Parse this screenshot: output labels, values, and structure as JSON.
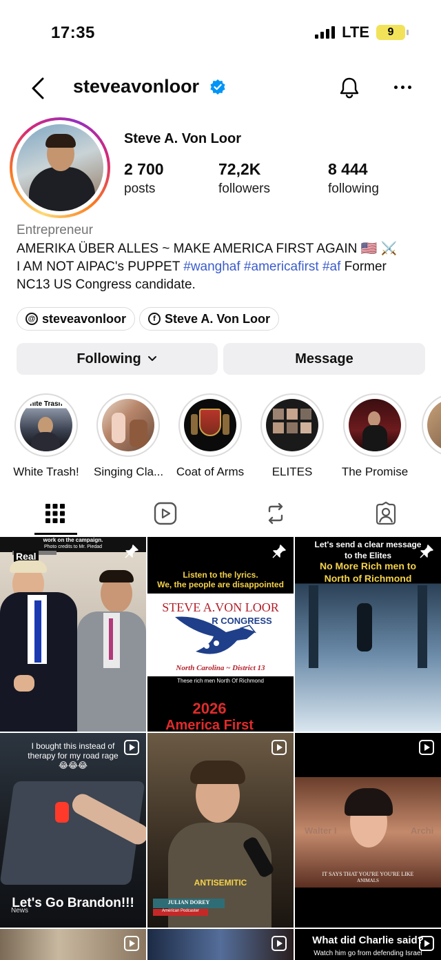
{
  "status_bar": {
    "time": "17:35",
    "network": "LTE",
    "battery": "9"
  },
  "header": {
    "username": "steveavonloor"
  },
  "profile": {
    "display_name": "Steve A. Von Loor",
    "stats": [
      {
        "num": "2 700",
        "label": "posts"
      },
      {
        "num": "72,2K",
        "label": "followers"
      },
      {
        "num": "8 444",
        "label": "following"
      }
    ],
    "category": "Entrepreneur",
    "bio_line1": "AMERIKA ÜBER ALLES ~ MAKE AMERICA FIRST AGAIN 🇺🇸 ⚔️",
    "bio_line2_prefix": "I AM NOT AIPAC's PUPPET ",
    "bio_tags": "#wanghaf #americafirst #af",
    "bio_line2_suffix": " Former",
    "bio_line3": "NC13 US Congress candidate.",
    "links": [
      {
        "label": "steveavonloor",
        "icon": "threads-icon"
      },
      {
        "label": "Steve A. Von Loor",
        "icon": "facebook-icon"
      }
    ]
  },
  "actions": {
    "following": "Following",
    "message": "Message"
  },
  "highlights": [
    {
      "label": "White Trash!",
      "overlay": "hite Trash"
    },
    {
      "label": "Singing Cla..."
    },
    {
      "label": "Coat of Arms"
    },
    {
      "label": "ELITES"
    },
    {
      "label": "The Promise"
    }
  ],
  "tabs": [
    "grid-tab",
    "reels-tab",
    "reposts-tab",
    "tagged-tab"
  ],
  "posts": [
    {
      "top": "work on the campaign.",
      "top2": "Photo credits to Mr. Piedad",
      "badge": "Real"
    },
    {
      "line1": "Listen to the lyrics.",
      "line2": "We, the people are disappointed",
      "title": "STEVE A.VON LOOR",
      "sub": "R CONGRESS",
      "district": "North Carolina ~ District 13",
      "note": "These rich men North Of Richmond",
      "year": "2026",
      "slogan": "America First"
    },
    {
      "line1": "Let's send a clear message",
      "line2": "to the Elites",
      "line3": "No More Rich men to",
      "line4": "North of Richmond"
    },
    {
      "line1": "I bought this instead of",
      "line2": "therapy for my road rage",
      "emoji": "😂😂😂",
      "bottom": "Let's Go Brandon!!!",
      "watermark": "News"
    },
    {
      "label": "ANTISEMITIC",
      "name": "JULIAN DOREY",
      "role": "American Podcaster"
    },
    {
      "overlay": "Walter I",
      "overlay2": "Archi",
      "subtitle": "IT SAYS THAT YOU'RE YOU'RE LIKE",
      "subtitle2": "ANIMALS"
    },
    {},
    {},
    {
      "line1": "What did Charlie said?",
      "line2": "Watch him go from defending Israel"
    }
  ]
}
